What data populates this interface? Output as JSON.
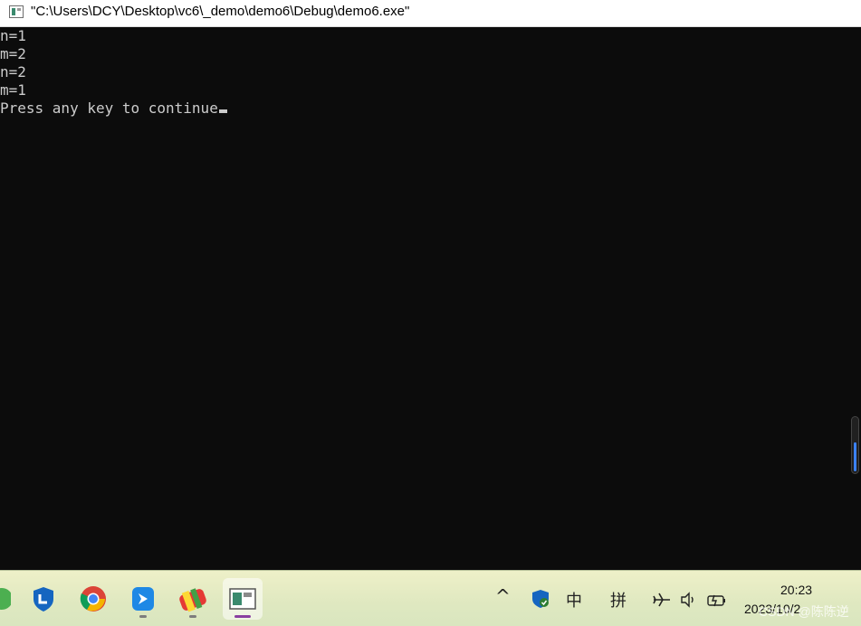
{
  "window": {
    "title": "\"C:\\Users\\DCY\\Desktop\\vc6\\_demo\\demo6\\Debug\\demo6.exe\"",
    "icon": "console-window-icon"
  },
  "console": {
    "lines": [
      "n=1",
      "m=2",
      "n=2",
      "m=1",
      "Press any key to continue"
    ],
    "text_color": "#cccccc",
    "background": "#0c0c0c"
  },
  "taskbar": {
    "apps": [
      {
        "name": "partial-green-app-icon"
      },
      {
        "name": "shield-app-icon"
      },
      {
        "name": "chrome-icon"
      },
      {
        "name": "feishu-icon"
      },
      {
        "name": "vc6-icon"
      },
      {
        "name": "console-app-icon"
      }
    ],
    "tray": {
      "chevron": "^",
      "ime_chinese": "中",
      "ime_pinyin": "拼",
      "icons": [
        "defender-icon",
        "airplane-icon",
        "volume-icon",
        "battery-icon"
      ]
    },
    "clock": {
      "time": "20:23",
      "date": "2023/10/2"
    },
    "accent": "#8a3fa0"
  },
  "watermark": "CSDN @陈陈逆"
}
